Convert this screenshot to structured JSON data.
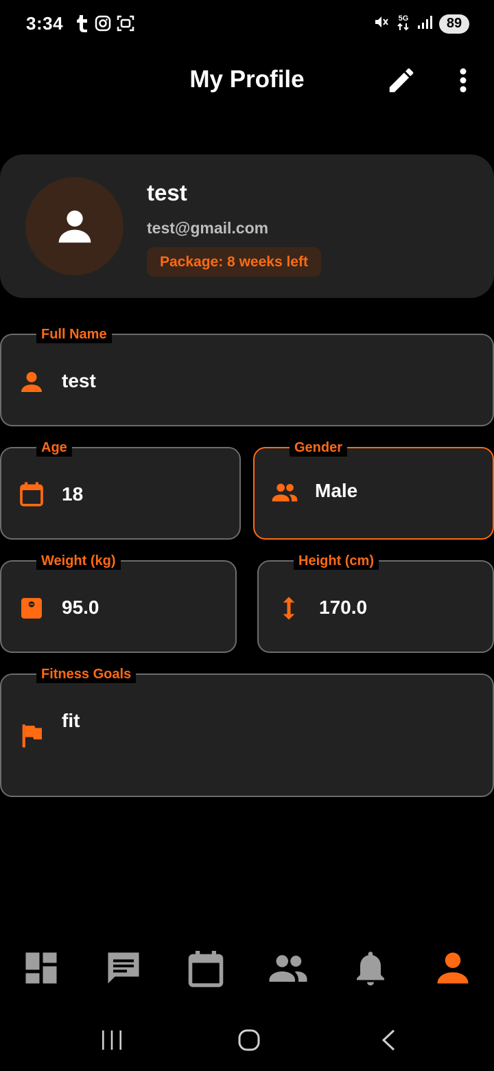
{
  "status_bar": {
    "time": "3:34",
    "network": "5G",
    "battery": "89"
  },
  "app_bar": {
    "title": "My Profile",
    "icons": [
      "edit-icon",
      "more-vert-icon"
    ]
  },
  "profile": {
    "name": "test",
    "email": "test@gmail.com",
    "package": "Package: 8 weeks left"
  },
  "fields": {
    "full_name": {
      "label": "Full Name",
      "value": "test",
      "icon": "person-icon"
    },
    "age": {
      "label": "Age",
      "value": "18",
      "icon": "calendar-icon"
    },
    "gender": {
      "label": "Gender",
      "value": "Male",
      "icon": "people-icon"
    },
    "weight": {
      "label": "Weight (kg)",
      "value": "95.0",
      "icon": "scale-icon"
    },
    "height": {
      "label": "Height (cm)",
      "value": "170.0",
      "icon": "height-arrow-icon"
    },
    "fitness_goals": {
      "label": "Fitness Goals",
      "value": "fit",
      "icon": "flag-icon"
    }
  },
  "bottom_nav": {
    "items": [
      "dashboard-icon",
      "chat-icon",
      "calendar-icon",
      "people-icon",
      "bell-icon",
      "profile-icon"
    ],
    "active": "profile-icon"
  },
  "colors": {
    "accent": "#ff6a13",
    "card": "#222222",
    "background": "#000000",
    "inactive_icon": "#9e9e9e"
  }
}
